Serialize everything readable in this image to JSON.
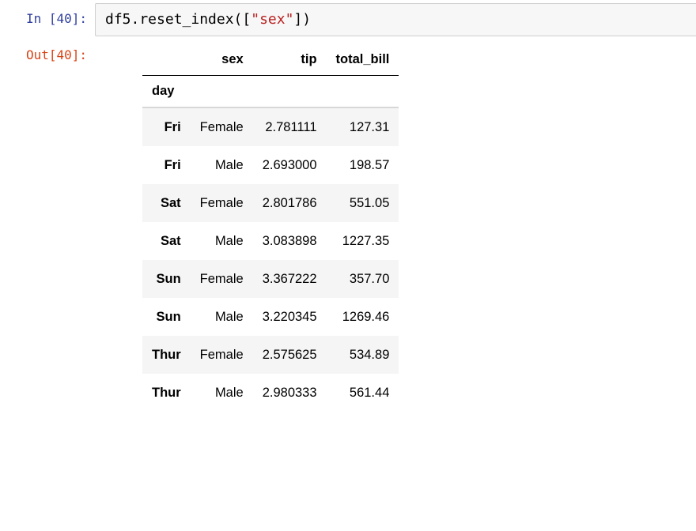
{
  "input_cell": {
    "prompt_prefix": "In [",
    "prompt_number": "40",
    "prompt_suffix": "]:",
    "code_pre": "df5.reset_index([",
    "code_string": "\"sex\"",
    "code_post": "])"
  },
  "output_cell": {
    "prompt_prefix": "Out[",
    "prompt_number": "40",
    "prompt_suffix": "]:"
  },
  "dataframe": {
    "index_name": "day",
    "columns": [
      "sex",
      "tip",
      "total_bill"
    ],
    "rows": [
      {
        "index": "Fri",
        "sex": "Female",
        "tip": "2.781111",
        "total_bill": "127.31"
      },
      {
        "index": "Fri",
        "sex": "Male",
        "tip": "2.693000",
        "total_bill": "198.57"
      },
      {
        "index": "Sat",
        "sex": "Female",
        "tip": "2.801786",
        "total_bill": "551.05"
      },
      {
        "index": "Sat",
        "sex": "Male",
        "tip": "3.083898",
        "total_bill": "1227.35"
      },
      {
        "index": "Sun",
        "sex": "Female",
        "tip": "3.367222",
        "total_bill": "357.70"
      },
      {
        "index": "Sun",
        "sex": "Male",
        "tip": "3.220345",
        "total_bill": "1269.46"
      },
      {
        "index": "Thur",
        "sex": "Female",
        "tip": "2.575625",
        "total_bill": "534.89"
      },
      {
        "index": "Thur",
        "sex": "Male",
        "tip": "2.980333",
        "total_bill": "561.44"
      }
    ]
  }
}
